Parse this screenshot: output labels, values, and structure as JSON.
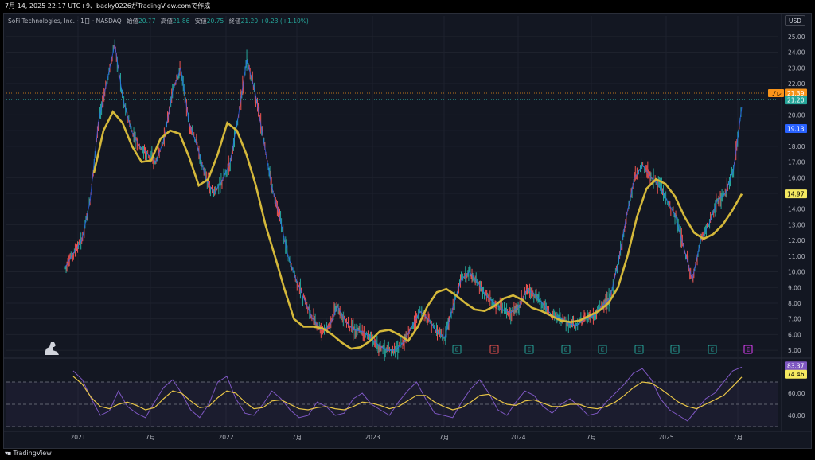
{
  "header": {
    "snapshot_text": "7月 14, 2025 22:17 UTC+9、backy0226がTradingView.comで作成"
  },
  "legend": {
    "symbol": "SoFi Technologies, Inc. · 1日 · NASDAQ",
    "open_label": "始値",
    "open": "20.77",
    "high_label": "高値",
    "high": "21.86",
    "low_label": "安値",
    "low": "20.75",
    "close_label": "終値",
    "close": "21.20",
    "change": "+0.23 (+1.10%)"
  },
  "currency": "USD",
  "footer": {
    "brand": "TradingView",
    "logo": "tradingview-logo-icon"
  },
  "colors": {
    "background": "#131722",
    "ma": "#d4b83a",
    "rsi": "#7e57c2",
    "rsi_ma": "#e8c547",
    "up": "#26a69a",
    "down": "#ef5350",
    "blue_wave": "#2962ff",
    "event_e_green": "#26a69a",
    "event_e_red": "#ef5350",
    "event_e_magenta": "#e040fb"
  },
  "chart_data": [
    {
      "type": "line",
      "y_axis_ticks": [
        "25.00",
        "24.00",
        "23.00",
        "22.00",
        "21.00",
        "20.00",
        "19.00",
        "18.00",
        "17.00",
        "16.00",
        "15.00",
        "14.00",
        "13.00",
        "12.00",
        "11.00",
        "10.00",
        "9.00",
        "8.00",
        "7.00",
        "6.00",
        "5.00"
      ],
      "x_axis_labels": [
        "2021",
        "7月",
        "2022",
        "7月",
        "2023",
        "7月",
        "2024",
        "7月",
        "2025",
        "7月"
      ],
      "ylim": [
        4.6,
        25.6
      ],
      "y_ticks_values": [
        25,
        24,
        23,
        22,
        21,
        20,
        19,
        18,
        17,
        16,
        15,
        14,
        13,
        12,
        11,
        10,
        9,
        8,
        7,
        6,
        5
      ],
      "price_labels": [
        {
          "text": "プレ",
          "value": 21.39,
          "color": "#f7931a"
        },
        {
          "text": "21.39",
          "value": 21.39,
          "color": "#f7931a"
        },
        {
          "text": "21.20",
          "value": 20.95,
          "color": "#26a69a"
        },
        {
          "text": "19.13",
          "value": 19.13,
          "color": "#2962ff"
        },
        {
          "text": "14.97",
          "value": 14.97,
          "color": "#f5e960"
        }
      ],
      "series": [
        {
          "values": [
            10.3,
            11.2,
            12.0,
            14.5,
            19.5,
            22.0,
            24.5,
            21.0,
            19.0,
            18.0,
            17.5,
            17.0,
            18.5,
            21.5,
            23.0,
            19.5,
            18.0,
            16.0,
            15.0,
            15.8,
            17.0,
            20.0,
            23.5,
            21.5,
            18.5,
            15.5,
            13.5,
            11.0,
            9.5,
            8.2,
            7.0,
            6.3,
            6.5,
            7.8,
            6.8,
            6.3,
            6.2,
            5.8,
            5.3,
            5.0,
            5.0,
            5.5,
            6.5,
            7.5,
            7.0,
            6.2,
            5.8,
            7.8,
            9.5,
            10.0,
            9.3,
            8.5,
            8.0,
            7.6,
            7.4,
            7.8,
            8.9,
            8.5,
            7.9,
            7.2,
            7.1,
            6.7,
            6.6,
            7.0,
            7.2,
            7.8,
            8.3,
            10.5,
            13.5,
            16.0,
            16.8,
            16.0,
            15.5,
            14.5,
            13.5,
            11.5,
            9.5,
            12.0,
            13.0,
            14.5,
            15.0,
            16.5,
            20.5
          ]
        },
        {
          "values": [
            16.3,
            19.0,
            20.2,
            19.5,
            18.0,
            17.0,
            17.1,
            18.5,
            19.0,
            18.8,
            17.3,
            15.5,
            15.9,
            17.5,
            19.5,
            19.0,
            17.5,
            15.5,
            13.0,
            11.0,
            8.9,
            7.0,
            6.5,
            6.5,
            6.4,
            6.0,
            5.5,
            5.1,
            5.2,
            5.6,
            6.2,
            6.3,
            6.0,
            5.6,
            6.5,
            7.8,
            8.7,
            8.9,
            8.5,
            8.0,
            7.6,
            7.5,
            7.8,
            8.3,
            8.5,
            8.2,
            7.7,
            7.5,
            7.2,
            6.9,
            6.8,
            6.9,
            7.2,
            7.5,
            8.0,
            9.0,
            11.0,
            13.5,
            15.3,
            15.9,
            15.6,
            14.8,
            13.5,
            12.5,
            12.1,
            12.4,
            13.0,
            13.9,
            14.97
          ]
        }
      ]
    },
    {
      "type": "line",
      "y_axis_ticks": [
        "60.00",
        "40.00"
      ],
      "ylim": [
        30,
        90
      ],
      "y_ticks_values": [
        60,
        40
      ],
      "price_labels": [
        {
          "text": "83.37",
          "value": 84.5,
          "color": "#7e57c2"
        },
        {
          "text": "74.46",
          "value": 77.0,
          "color": "#f5e960"
        }
      ],
      "series": [
        {
          "values": [
            80,
            72,
            55,
            40,
            44,
            62,
            48,
            42,
            38,
            52,
            65,
            72,
            60,
            45,
            38,
            50,
            70,
            75,
            55,
            42,
            40,
            50,
            62,
            55,
            45,
            38,
            40,
            52,
            48,
            40,
            42,
            55,
            60,
            50,
            45,
            40,
            52,
            62,
            70,
            55,
            42,
            40,
            38,
            52,
            64,
            72,
            60,
            45,
            40,
            52,
            62,
            58,
            48,
            42,
            50,
            55,
            48,
            40,
            42,
            52,
            60,
            68,
            78,
            82,
            72,
            55,
            45,
            40,
            35,
            45,
            55,
            60,
            70,
            80,
            83.37
          ]
        },
        {
          "values": [
            75,
            68,
            56,
            48,
            46,
            50,
            52,
            49,
            45,
            47,
            55,
            62,
            60,
            53,
            47,
            48,
            56,
            62,
            60,
            52,
            46,
            47,
            53,
            54,
            50,
            46,
            45,
            47,
            48,
            46,
            45,
            48,
            52,
            51,
            49,
            46,
            48,
            53,
            58,
            58,
            52,
            48,
            45,
            47,
            52,
            58,
            59,
            54,
            50,
            49,
            53,
            54,
            51,
            48,
            48,
            50,
            50,
            47,
            46,
            48,
            52,
            58,
            65,
            70,
            69,
            64,
            58,
            52,
            48,
            46,
            50,
            54,
            58,
            66,
            74.46
          ]
        }
      ]
    }
  ],
  "events": [
    {
      "letter": "E",
      "color": "#26a69a"
    },
    {
      "letter": "E",
      "color": "#ef5350"
    },
    {
      "letter": "E",
      "color": "#26a69a"
    },
    {
      "letter": "E",
      "color": "#26a69a"
    },
    {
      "letter": "E",
      "color": "#26a69a"
    },
    {
      "letter": "E",
      "color": "#26a69a"
    },
    {
      "letter": "E",
      "color": "#26a69a"
    },
    {
      "letter": "E",
      "color": "#26a69a"
    },
    {
      "letter": "E",
      "color": "#e040fb"
    }
  ]
}
